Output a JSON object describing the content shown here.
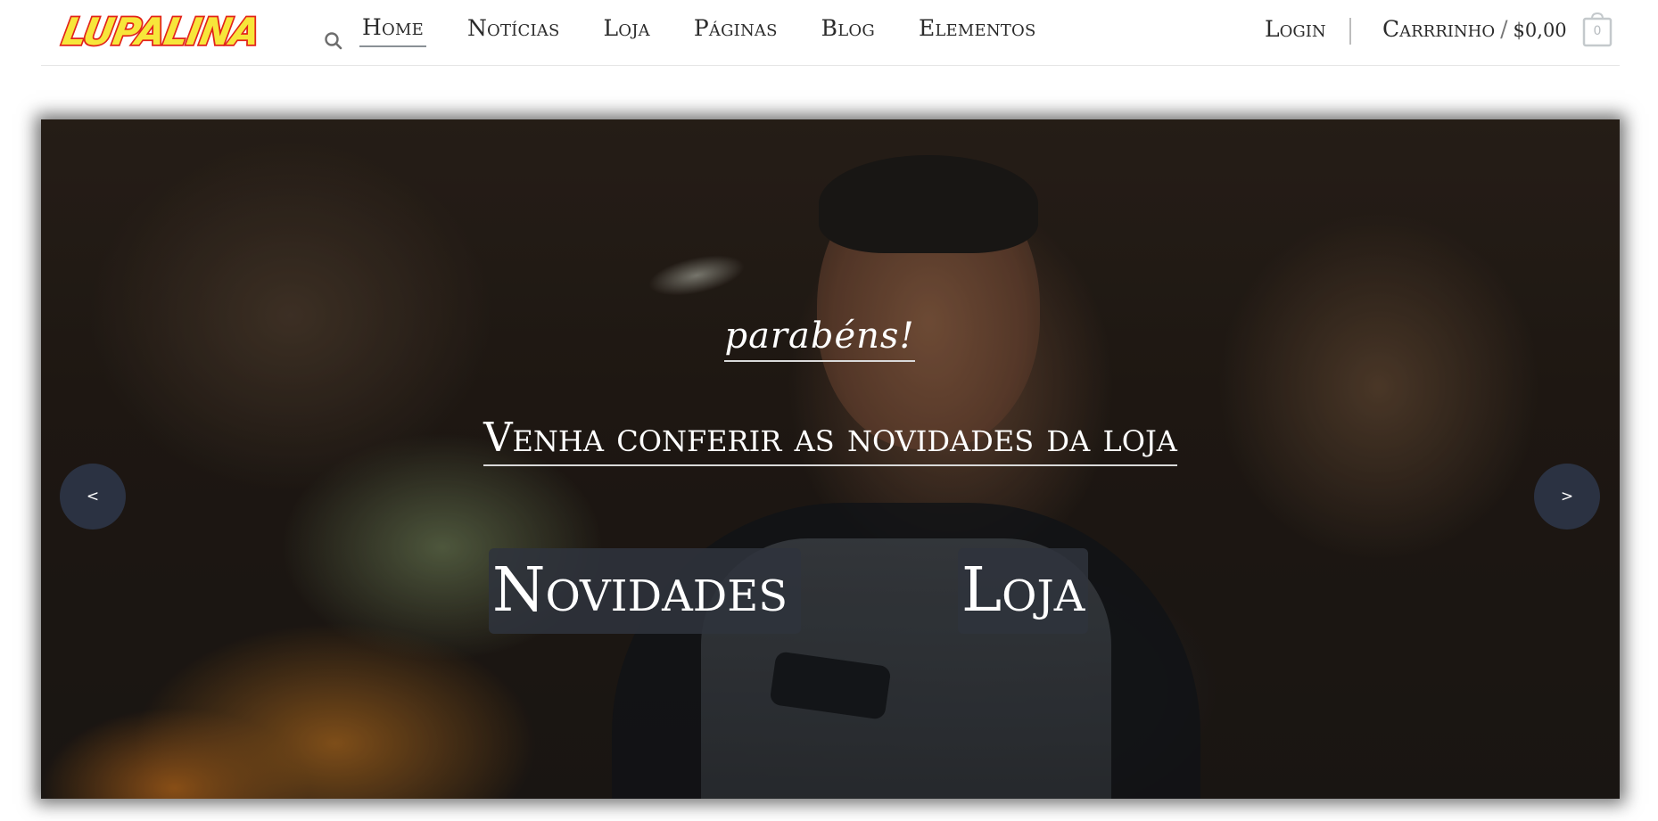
{
  "logo": {
    "text": "LUPALINA"
  },
  "nav": {
    "items": [
      {
        "label": "Home"
      },
      {
        "label": "Notícias"
      },
      {
        "label": "Loja"
      },
      {
        "label": "Páginas"
      },
      {
        "label": "Blog"
      },
      {
        "label": "Elementos"
      }
    ]
  },
  "account": {
    "login_label": "Login",
    "cart_label": "Carrrinho",
    "cart_separator": "/",
    "cart_total": "$0,00",
    "cart_count": "0"
  },
  "hero": {
    "kicker": "parabéns!",
    "title": "Venha conferir as novidades da loja",
    "buttons": [
      {
        "label": "Novidades"
      },
      {
        "label": "Loja"
      }
    ],
    "prev_label": "<",
    "next_label": ">"
  },
  "colors": {
    "logo_fill": "#f7e63a",
    "logo_outline": "#e2231a",
    "button_bg": "#2f333c",
    "arrow_bg": "#2b3242"
  },
  "icons": {
    "search": "search-icon",
    "cart": "shopping-bag-icon"
  }
}
